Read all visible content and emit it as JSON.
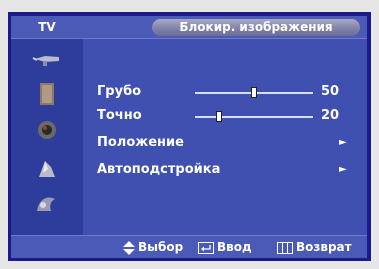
{
  "header": {
    "source_label": "TV",
    "title": "Блокир. изображения"
  },
  "sidebar": {
    "items": [
      {
        "icon": "antenna-icon"
      },
      {
        "icon": "picture-icon"
      },
      {
        "icon": "sound-icon"
      },
      {
        "icon": "setup-icon"
      },
      {
        "icon": "input-icon"
      }
    ]
  },
  "menu": {
    "items": [
      {
        "label": "Грубо",
        "value": "50",
        "level": 0.5
      },
      {
        "label": "Точно",
        "value": "20",
        "level": 0.2
      },
      {
        "label": "Положение",
        "arrow": "►"
      },
      {
        "label": "Автоподстройка",
        "arrow": "►"
      }
    ]
  },
  "footer": {
    "move_label": "Выбор",
    "enter_label": "Ввод",
    "return_label": "Возврат"
  },
  "colors": {
    "background": "#3a4aa8",
    "bar": "#4a5ab6",
    "text": "#ffffff"
  }
}
